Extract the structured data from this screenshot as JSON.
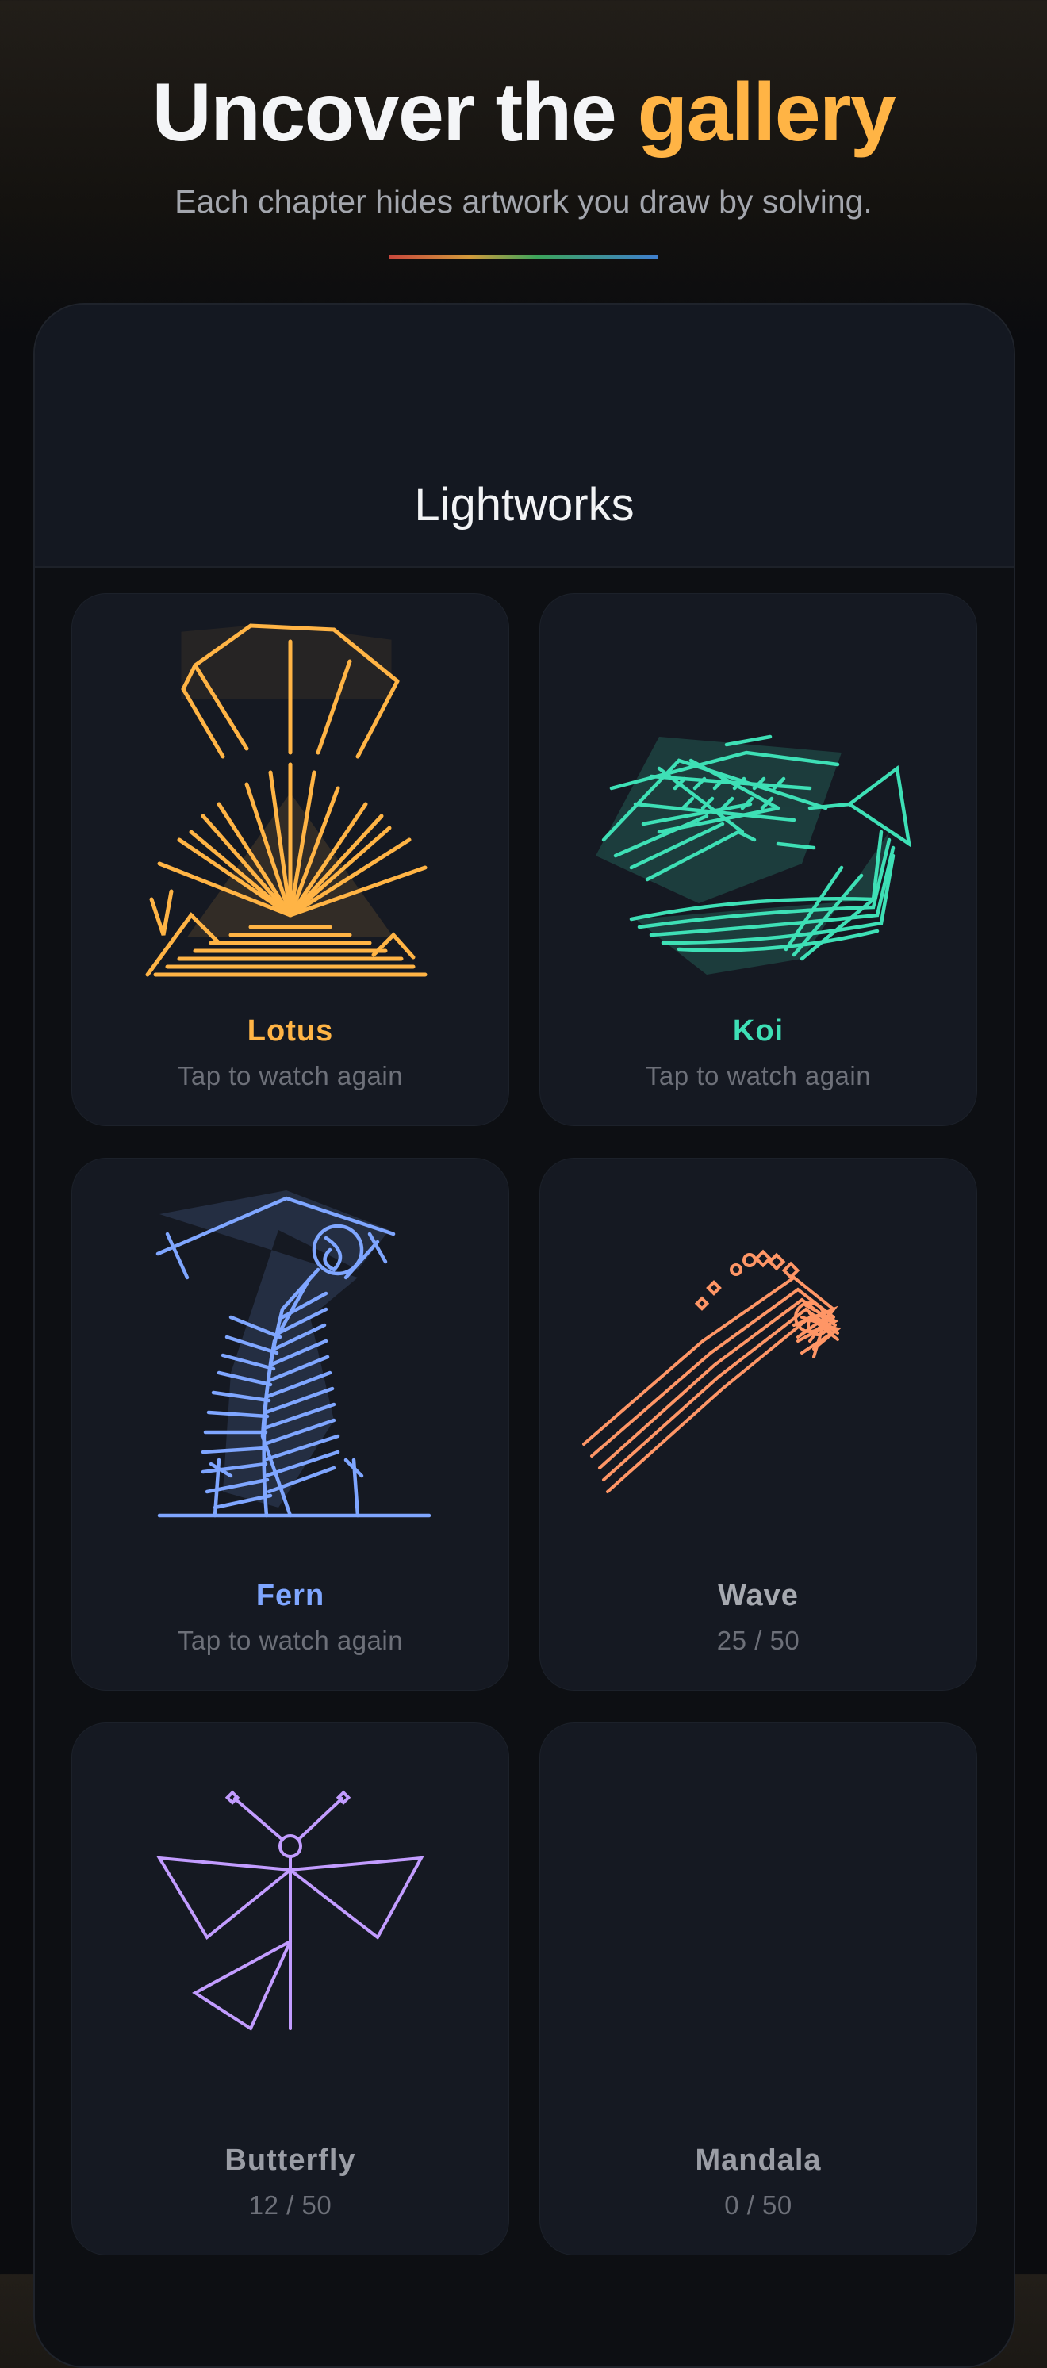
{
  "header": {
    "title_prefix": "Uncover the ",
    "title_accent": "gallery",
    "subtitle": "Each chapter hides artwork you draw by solving."
  },
  "chapter": {
    "title": "Lightworks"
  },
  "colors": {
    "accent": "#ffb445",
    "lotus": "#ffb445",
    "koi": "#3ee0b6",
    "fern": "#7fa6ff",
    "wave": "#ff9666",
    "butterfly": "#c29cff",
    "locked_text": "#9a9da5"
  },
  "artworks": [
    {
      "name": "Lotus",
      "status": "Tap to watch again",
      "icon": "lotus-artwork",
      "progress": 1.0
    },
    {
      "name": "Koi",
      "status": "Tap to watch again",
      "icon": "koi-artwork",
      "progress": 1.0
    },
    {
      "name": "Fern",
      "status": "Tap to watch again",
      "icon": "fern-artwork",
      "progress": 1.0
    },
    {
      "name": "Wave",
      "status": "25 / 50",
      "icon": "wave-artwork",
      "progress": 0.5
    },
    {
      "name": "Butterfly",
      "status": "12 / 50",
      "icon": "butterfly-artwork",
      "progress": 0.24
    },
    {
      "name": "Mandala",
      "status": "0 / 50",
      "icon": "mandala-artwork",
      "progress": 0.0
    }
  ]
}
